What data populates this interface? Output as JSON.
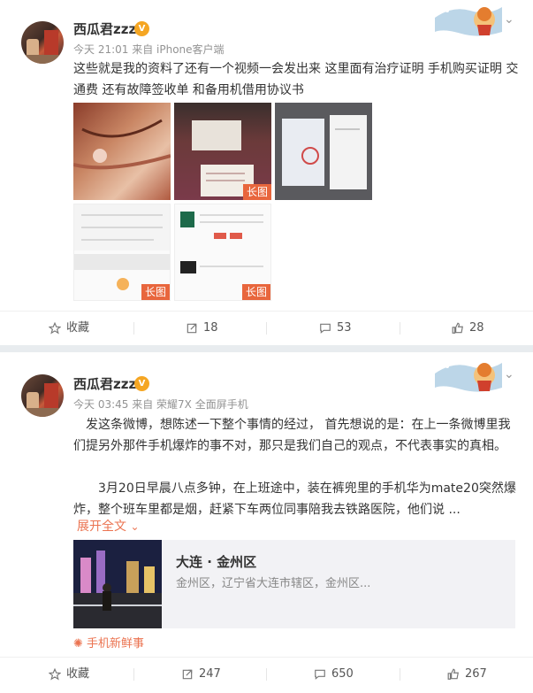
{
  "posts": [
    {
      "username": "西瓜君zzz",
      "verified_badge": "V",
      "meta": "今天 21:01 来自 iPhone客户端",
      "text": "这些就是我的资料了还有一个视频一会发出来 这里面有治疗证明 手机购买证明 交通费 还有故障签收单 和备用机借用协议书",
      "images": [
        {
          "icon": "injury-photo",
          "badge": null
        },
        {
          "icon": "document-photo",
          "badge": "长图"
        },
        {
          "icon": "receipt-photo",
          "badge": null
        },
        {
          "icon": "payment-screenshot",
          "badge": "长图"
        },
        {
          "icon": "order-screenshot",
          "badge": "长图"
        }
      ],
      "footer": {
        "favorite": "收藏",
        "repost": "18",
        "comment": "53",
        "like": "28"
      }
    },
    {
      "username": "西瓜君zzz",
      "verified_badge": "V",
      "meta": "今天 03:45 来自 荣耀7X 全面屏手机",
      "text_p1": "发这条微博，想陈述一下整个事情的经过，  首先想说的是：在上一条微博里我们提另外那件手机爆炸的事不对，那只是我们自己的观点，不代表事实的真相。",
      "text_p2": "3月20日早晨八点多钟，在上班途中，装在裤兜里的手机华为mate20突然爆炸，整个班车里都是烟，赶紧下车两位同事陪我去铁路医院，他们说 ...",
      "expand": "展开全文",
      "location": {
        "title": "大连 · 金州区",
        "subtitle": "金州区，辽宁省大连市辖区，金州区..."
      },
      "topic": "手机新鲜事",
      "footer": {
        "favorite": "收藏",
        "repost": "247",
        "comment": "650",
        "like": "267"
      }
    }
  ],
  "colors": {
    "accent": "#eb7350",
    "badge": "#e8663d",
    "bg": "#e8ecef"
  }
}
